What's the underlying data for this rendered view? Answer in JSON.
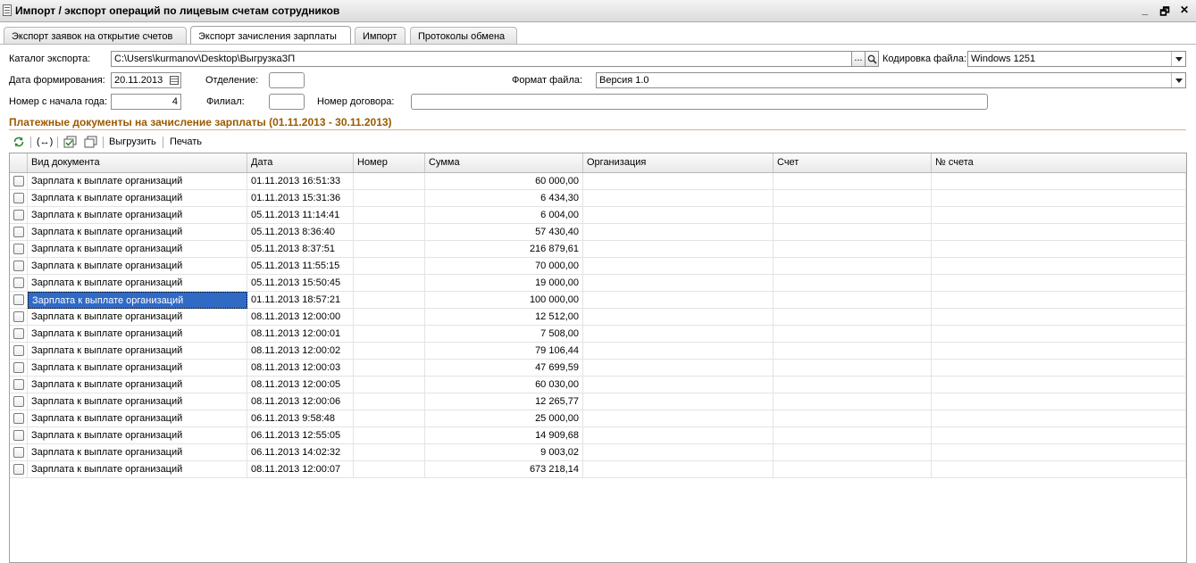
{
  "window": {
    "title": "Импорт / экспорт операций по лицевым счетам сотрудников",
    "buttons": {
      "minimize": "_",
      "restore": "🗗",
      "close": "✕"
    }
  },
  "tabs": [
    {
      "label": "Экспорт заявок на открытие счетов"
    },
    {
      "label": "Экспорт зачисления зарплаты"
    },
    {
      "label": "Импорт"
    },
    {
      "label": "Протоколы обмена"
    }
  ],
  "form": {
    "catalog_label": "Каталог экспорта:",
    "catalog_value": "C:\\Users\\kurmanov\\Desktop\\ВыгрузкаЗП",
    "browse_label": "...",
    "encoding_label": "Кодировка файла:",
    "encoding_value": "Windows 1251",
    "date_label": "Дата формирования:",
    "date_value": "20.11.2013",
    "department_label": "Отделение:",
    "department_value": "",
    "format_label": "Формат файла:",
    "format_value": "Версия 1.0",
    "number_label": "Номер с начала года:",
    "number_value": "4",
    "branch_label": "Филиал:",
    "branch_value": "",
    "contract_label": "Номер договора:",
    "contract_value": ""
  },
  "section": {
    "title": "Платежные документы на зачисление зарплаты (01.11.2013 - 30.11.2013)"
  },
  "toolbar": {
    "export_label": "Выгрузить",
    "print_label": "Печать",
    "range_label": "(↔)"
  },
  "table": {
    "columns": [
      "Вид документа",
      "Дата",
      "Номер",
      "Сумма",
      "Организация",
      "Счет",
      "№ счета"
    ],
    "selected_row": 7,
    "rows": [
      {
        "type": "Зарплата к выплате организаций",
        "date": "01.11.2013 16:51:33",
        "number": "",
        "sum": "60 000,00",
        "org": "",
        "account": "",
        "account_no": ""
      },
      {
        "type": "Зарплата к выплате организаций",
        "date": "01.11.2013 15:31:36",
        "number": "",
        "sum": "6 434,30",
        "org": "",
        "account": "",
        "account_no": ""
      },
      {
        "type": "Зарплата к выплате организаций",
        "date": "05.11.2013 11:14:41",
        "number": "",
        "sum": "6 004,00",
        "org": "",
        "account": "",
        "account_no": ""
      },
      {
        "type": "Зарплата к выплате организаций",
        "date": "05.11.2013 8:36:40",
        "number": "",
        "sum": "57 430,40",
        "org": "",
        "account": "",
        "account_no": ""
      },
      {
        "type": "Зарплата к выплате организаций",
        "date": "05.11.2013 8:37:51",
        "number": "",
        "sum": "216 879,61",
        "org": "",
        "account": "",
        "account_no": ""
      },
      {
        "type": "Зарплата к выплате организаций",
        "date": "05.11.2013 11:55:15",
        "number": "",
        "sum": "70 000,00",
        "org": "",
        "account": "",
        "account_no": ""
      },
      {
        "type": "Зарплата к выплате организаций",
        "date": "05.11.2013 15:50:45",
        "number": "",
        "sum": "19 000,00",
        "org": "",
        "account": "",
        "account_no": ""
      },
      {
        "type": "Зарплата к выплате организаций",
        "date": "01.11.2013 18:57:21",
        "number": "",
        "sum": "100 000,00",
        "org": "",
        "account": "",
        "account_no": ""
      },
      {
        "type": "Зарплата к выплате организаций",
        "date": "08.11.2013 12:00:00",
        "number": "",
        "sum": "12 512,00",
        "org": "",
        "account": "",
        "account_no": ""
      },
      {
        "type": "Зарплата к выплате организаций",
        "date": "08.11.2013 12:00:01",
        "number": "",
        "sum": "7 508,00",
        "org": "",
        "account": "",
        "account_no": ""
      },
      {
        "type": "Зарплата к выплате организаций",
        "date": "08.11.2013 12:00:02",
        "number": "",
        "sum": "79 106,44",
        "org": "",
        "account": "",
        "account_no": ""
      },
      {
        "type": "Зарплата к выплате организаций",
        "date": "08.11.2013 12:00:03",
        "number": "",
        "sum": "47 699,59",
        "org": "",
        "account": "",
        "account_no": ""
      },
      {
        "type": "Зарплата к выплате организаций",
        "date": "08.11.2013 12:00:05",
        "number": "",
        "sum": "60 030,00",
        "org": "",
        "account": "",
        "account_no": ""
      },
      {
        "type": "Зарплата к выплате организаций",
        "date": "08.11.2013 12:00:06",
        "number": "",
        "sum": "12 265,77",
        "org": "",
        "account": "",
        "account_no": ""
      },
      {
        "type": "Зарплата к выплате организаций",
        "date": "06.11.2013 9:58:48",
        "number": "",
        "sum": "25 000,00",
        "org": "",
        "account": "",
        "account_no": ""
      },
      {
        "type": "Зарплата к выплате организаций",
        "date": "06.11.2013 12:55:05",
        "number": "",
        "sum": "14 909,68",
        "org": "",
        "account": "",
        "account_no": ""
      },
      {
        "type": "Зарплата к выплате организаций",
        "date": "06.11.2013 14:02:32",
        "number": "",
        "sum": "9 003,02",
        "org": "",
        "account": "",
        "account_no": ""
      },
      {
        "type": "Зарплата к выплате организаций",
        "date": "08.11.2013 12:00:07",
        "number": "",
        "sum": "673 218,14",
        "org": "",
        "account": "",
        "account_no": ""
      }
    ]
  },
  "colors": {
    "section_title": "#9a5a00",
    "selection": "#316ac5",
    "refresh_icon": "#2e8b2e"
  },
  "icons": {
    "refresh": "refresh-icon",
    "range": "range-icon",
    "check_all": "check-all-icon",
    "uncheck_all": "uncheck-all-icon",
    "search": "search-icon",
    "calendar": "calendar-icon"
  }
}
